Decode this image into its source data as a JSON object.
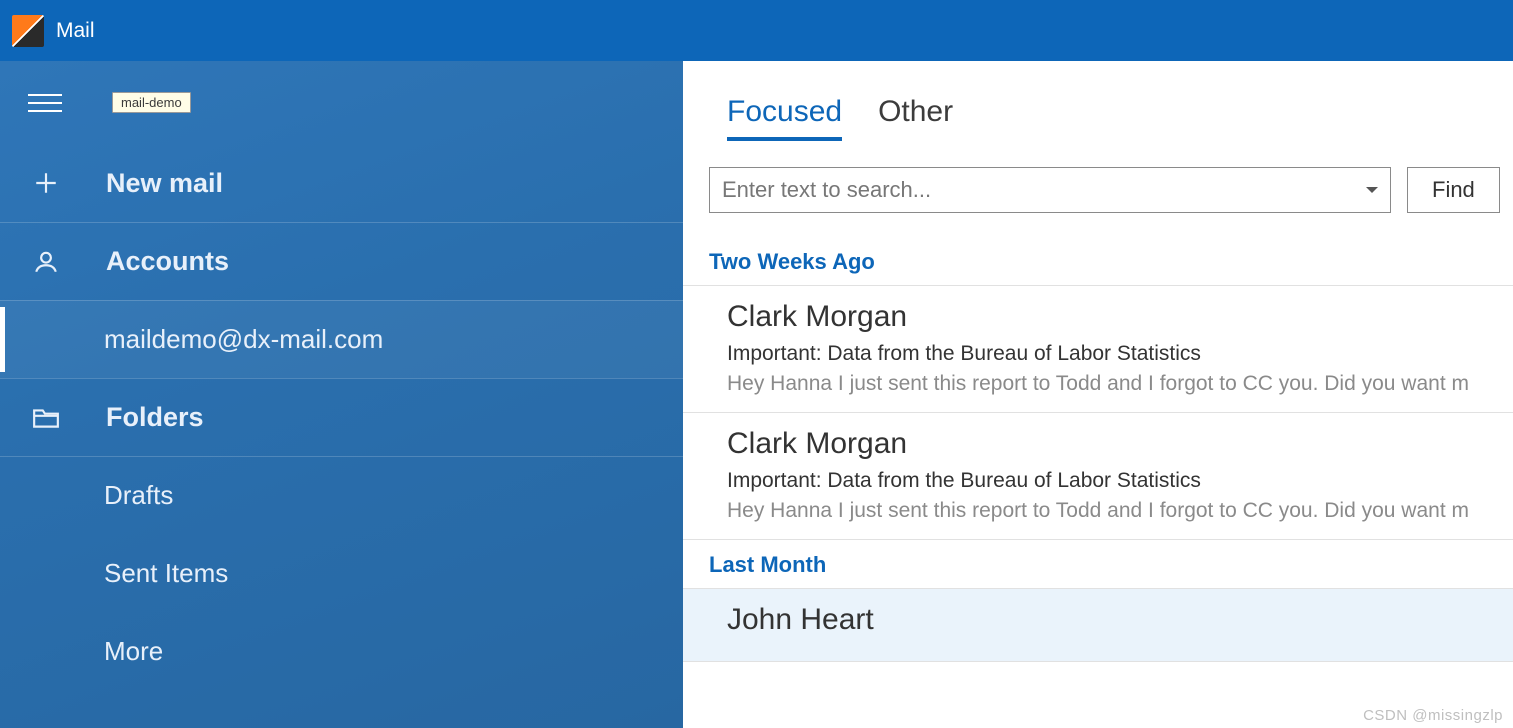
{
  "app": {
    "title": "Mail"
  },
  "sidebar": {
    "tooltip": "mail-demo",
    "new_mail": "New mail",
    "accounts_label": "Accounts",
    "account_email": "maildemo@dx-mail.com",
    "folders_label": "Folders",
    "folders": {
      "drafts": "Drafts",
      "sent": "Sent Items",
      "more": "More"
    }
  },
  "tabs": {
    "focused": "Focused",
    "other": "Other"
  },
  "search": {
    "placeholder": "Enter text to search...",
    "find_label": "Find"
  },
  "groups": [
    {
      "header": "Two Weeks Ago",
      "items": [
        {
          "sender": "Clark Morgan",
          "subject": "Important: Data from the Bureau of Labor Statistics",
          "preview": "Hey Hanna   I just sent this report to Todd and I forgot to CC you. Did you want m"
        },
        {
          "sender": "Clark Morgan",
          "subject": "Important: Data from the Bureau of Labor Statistics",
          "preview": "Hey Hanna   I just sent this report to Todd and I forgot to CC you. Did you want m"
        }
      ]
    },
    {
      "header": "Last Month",
      "items": [
        {
          "sender": "John Heart",
          "subject": "",
          "preview": ""
        }
      ]
    }
  ],
  "watermark": "CSDN @missingzlp"
}
